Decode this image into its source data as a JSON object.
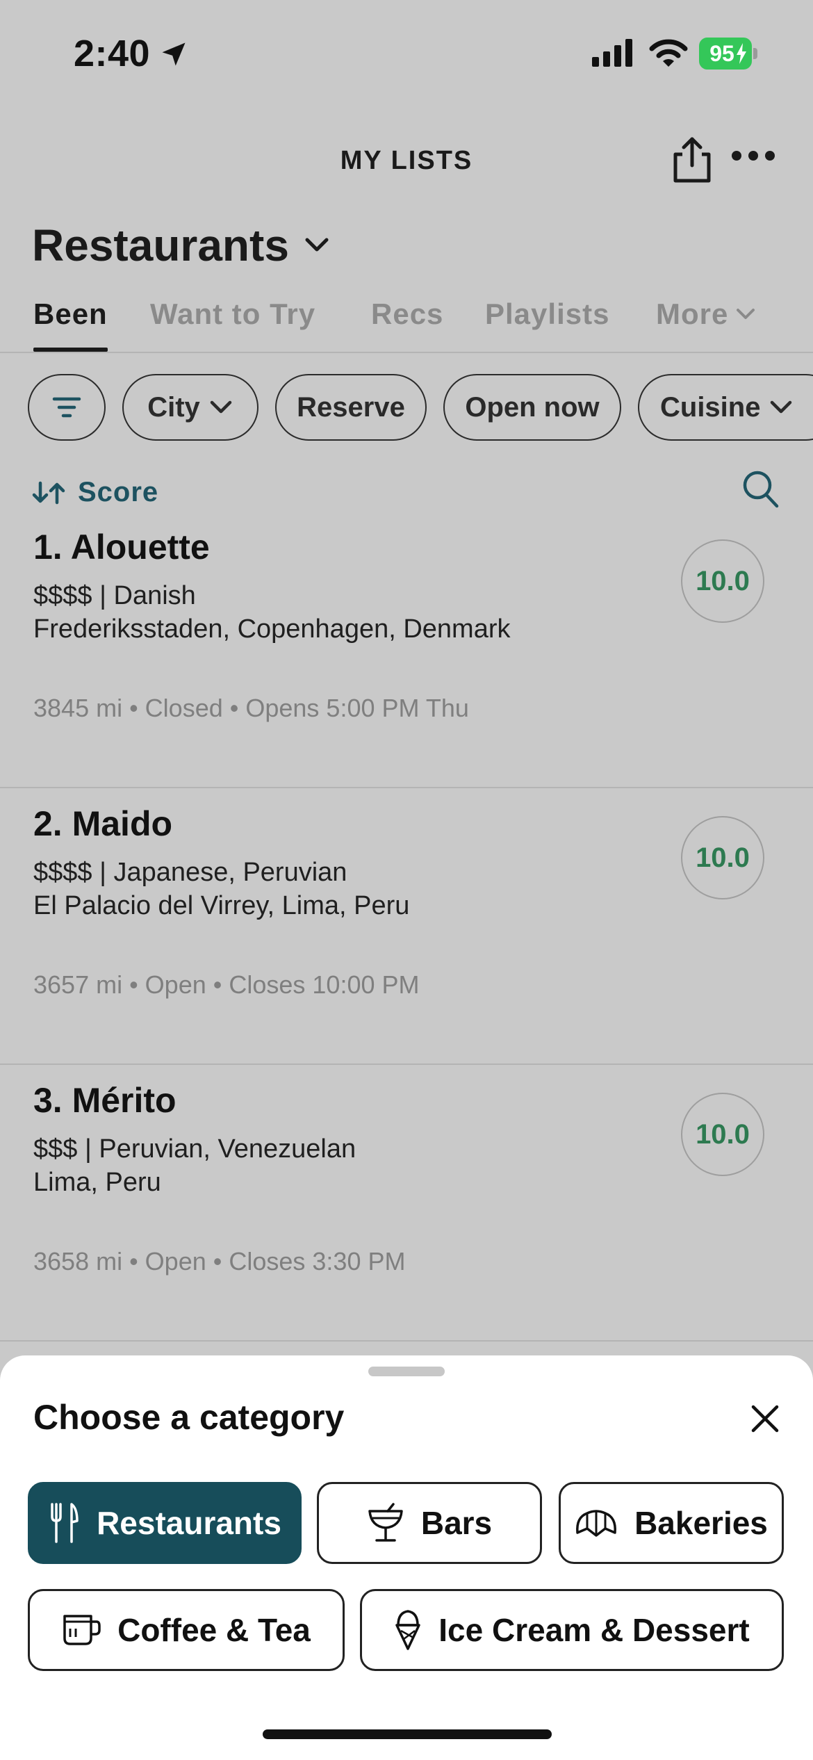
{
  "status_bar": {
    "time": "2:40",
    "battery": "95"
  },
  "header": {
    "title": "MY LISTS",
    "share_icon": "share-icon",
    "more_icon": "ellipsis-icon"
  },
  "list": {
    "title": "Restaurants"
  },
  "tabs": [
    {
      "label": "Been",
      "active": true
    },
    {
      "label": "Want to Try"
    },
    {
      "label": "Recs"
    },
    {
      "label": "Playlists"
    },
    {
      "label": "More"
    }
  ],
  "filters": {
    "city": "City",
    "reserve": "Reserve",
    "open_now": "Open now",
    "cuisine": "Cuisine"
  },
  "sort": {
    "label": "Score"
  },
  "restaurants": [
    {
      "name": "1. Alouette",
      "line1": "$$$$ | Danish",
      "line2": "Frederiksstaden, Copenhagen, Denmark",
      "meta": "3845 mi • Closed • Opens 5:00 PM Thu",
      "score": "10.0"
    },
    {
      "name": "2. Maido",
      "line1": "$$$$ | Japanese, Peruvian",
      "line2": "El Palacio del Virrey, Lima, Peru",
      "meta": "3657 mi • Open • Closes 10:00 PM",
      "score": "10.0"
    },
    {
      "name": "3. Mérito",
      "line1": "$$$ | Peruvian, Venezuelan",
      "line2": "Lima, Peru",
      "meta": "3658 mi • Open • Closes 3:30 PM",
      "score": "10.0"
    }
  ],
  "sheet": {
    "title": "Choose a category",
    "categories": [
      {
        "label": "Restaurants",
        "icon": "fork-knife-icon",
        "selected": true
      },
      {
        "label": "Bars",
        "icon": "cocktail-icon"
      },
      {
        "label": "Bakeries",
        "icon": "croissant-icon"
      },
      {
        "label": "Coffee & Tea",
        "icon": "coffee-cup-icon"
      },
      {
        "label": "Ice Cream & Dessert",
        "icon": "ice-cream-icon"
      }
    ]
  },
  "colors": {
    "accent": "#174d5a",
    "score": "#2d7a50",
    "battery": "#34c759"
  }
}
